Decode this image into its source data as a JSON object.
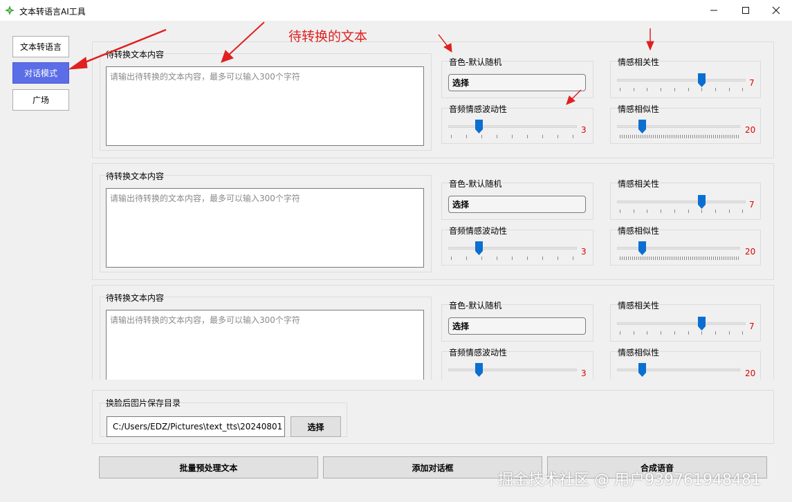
{
  "window": {
    "title": "文本转语言AI工具",
    "minimize_icon": "minimize-icon",
    "maximize_icon": "maximize-icon",
    "close_icon": "close-icon"
  },
  "nav": {
    "items": [
      {
        "label": "文本转语言",
        "active": false
      },
      {
        "label": "对话模式",
        "active": true
      },
      {
        "label": "广场",
        "active": false
      }
    ]
  },
  "dialog_blocks": [
    {
      "text_group_label": "待转换文本内容",
      "text_placeholder": "请输出待转换的文本内容，最多可以输入300个字符",
      "voice_label": "音色-默认随机",
      "voice_button": "选择",
      "fluctuation_label": "音频情感波动性",
      "fluctuation_value": "3",
      "relevance_label": "情感相关性",
      "relevance_value": "7",
      "similarity_label": "情感相似性",
      "similarity_value": "20"
    },
    {
      "text_group_label": "待转换文本内容",
      "text_placeholder": "请输出待转换的文本内容，最多可以输入300个字符",
      "voice_label": "音色-默认随机",
      "voice_button": "选择",
      "fluctuation_label": "音频情感波动性",
      "fluctuation_value": "3",
      "relevance_label": "情感相关性",
      "relevance_value": "7",
      "similarity_label": "情感相似性",
      "similarity_value": "20"
    },
    {
      "text_group_label": "待转换文本内容",
      "text_placeholder": "请输出待转换的文本内容，最多可以输入300个字符",
      "voice_label": "音色-默认随机",
      "voice_button": "选择",
      "fluctuation_label": "音频情感波动性",
      "fluctuation_value": "3",
      "relevance_label": "情感相关性",
      "relevance_value": "7",
      "similarity_label": "情感相似性",
      "similarity_value": "20"
    }
  ],
  "save_dir": {
    "label": "换脸后图片保存目录",
    "path": "C:/Users/EDZ/Pictures\\text_tts\\20240801",
    "button": "选择"
  },
  "actions": {
    "preprocess": "批量预处理文本",
    "add_dialog": "添加对话框",
    "synthesize": "合成语音"
  },
  "annotation": {
    "text": "待转换的文本",
    "color": "#e02020"
  },
  "watermark": "掘金技术社区 @ 用户939761948481",
  "colors": {
    "accent": "#5b6ee8",
    "slider_thumb": "#0b6fd1",
    "value_red": "#e00000"
  }
}
